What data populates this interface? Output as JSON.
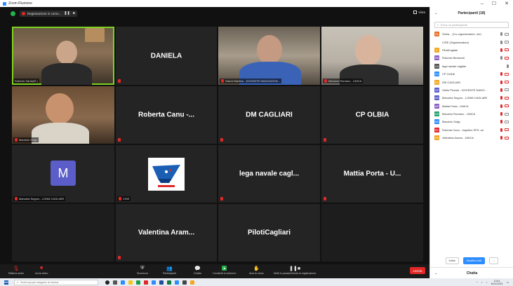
{
  "window": {
    "title": "Zoom Riunione"
  },
  "topbar": {
    "recording_label": "Registrazione in corso...",
    "view_label": "Vista"
  },
  "tiles": [
    {
      "kind": "video",
      "name": "Roberto Sardo(R.)",
      "active": true
    },
    {
      "kind": "name",
      "name": "DANIELA",
      "muted": true
    },
    {
      "kind": "video",
      "name": "Gianni Martino - DOCENTE NAVIGAZION..."
    },
    {
      "kind": "video",
      "name": "Maurizio Romano - UNICA"
    },
    {
      "kind": "video",
      "name": "Maurizio Solgo"
    },
    {
      "kind": "name",
      "name": "Roberta Canu -...",
      "muted": true
    },
    {
      "kind": "name",
      "name": "DM CAGLIARI",
      "muted": true
    },
    {
      "kind": "name",
      "name": "CP OLBIA",
      "muted": true
    },
    {
      "kind": "avatar",
      "name": "Manuela Seguro - LGNM CAGLIARI",
      "avatar_letter": "M"
    },
    {
      "kind": "logo",
      "name": "CISE"
    },
    {
      "kind": "name",
      "name": "lega navale cagl...",
      "muted": true
    },
    {
      "kind": "name",
      "name": "Mattia Porta - U...",
      "muted": true
    },
    {
      "kind": "empty",
      "name": ""
    },
    {
      "kind": "name",
      "name": "Valentina Aram...",
      "muted": true
    },
    {
      "kind": "name",
      "name": "PilotiCagliari",
      "muted": true
    },
    {
      "kind": "empty",
      "name": ""
    }
  ],
  "toolbar": {
    "audio_label": "Riattiva audio",
    "video_label": "Avvia video",
    "security_label": "Sicurezza",
    "participants_label": "Partecipanti",
    "participants_count": "18",
    "chat_label": "Chatta",
    "share_label": "Condividi lo schermo",
    "reactions_label": "Alza la mano",
    "record_label": "Metti in pausa/Arresta la registrazione",
    "leave_label": "Lascia"
  },
  "panel": {
    "title": "Partecipanti (18)",
    "search_placeholder": "Trova un partecipante",
    "participants": [
      {
        "initials": "GL",
        "color": "#e8702a",
        "name": "Giulia... (Co-organizzatore, me)",
        "mic": "on",
        "cam": "on"
      },
      {
        "initials": "",
        "color": "#1a5fb4",
        "name": "CISE (Organizzatore)",
        "mic": "on",
        "cam": "on",
        "bird": true
      },
      {
        "initials": "P",
        "color": "#f5a623",
        "name": "PilotiCagliari",
        "mic": "off",
        "cam": "off"
      },
      {
        "initials": "RB",
        "color": "#8a5fc7",
        "name": "Roberto Bertacchi",
        "mic": "on",
        "cam": "off"
      },
      {
        "initials": "LN",
        "color": "#555555",
        "name": "lega navale cagliari",
        "mic": "on",
        "cam": "none"
      },
      {
        "initials": "CO",
        "color": "#2d8cff",
        "name": "CP OLBIA",
        "mic": "off",
        "cam": "off"
      },
      {
        "initials": "DC",
        "color": "#f5a623",
        "name": "DM CAGLIARI",
        "mic": "off",
        "cam": "off"
      },
      {
        "initials": "GP",
        "color": "#5b5ec8",
        "name": "Giulio Piccolo - DOCENTE NAVIG...",
        "mic": "off",
        "cam": "on"
      },
      {
        "initials": "MS",
        "color": "#5b5ec8",
        "name": "Manuela Seguro - LGNM CAGLIARI",
        "mic": "off",
        "cam": "off"
      },
      {
        "initials": "MP",
        "color": "#8a5fc7",
        "name": "Mattia Porta - UNICA",
        "mic": "off",
        "cam": "off"
      },
      {
        "initials": "MR",
        "color": "#22a06b",
        "name": "Maurizio Romano - UNICA",
        "mic": "off",
        "cam": "on"
      },
      {
        "initials": "MS",
        "color": "#2d8cff",
        "name": "Maurizio Solgo",
        "mic": "off",
        "cam": "on"
      },
      {
        "initials": "RC",
        "color": "#e02828",
        "name": "Roberta Canu - Inquilino SPS..srl",
        "mic": "off",
        "cam": "off"
      },
      {
        "initials": "VA",
        "color": "#f5a623",
        "name": "Valentina Aramu - UNICA",
        "mic": "off",
        "cam": "off"
      }
    ],
    "invite_label": "Invita",
    "mute_all_label": "Disattiva tutti",
    "more_label": "...",
    "chat_title": "Chatta"
  },
  "taskbar": {
    "search_placeholder": "Scrivi qui per eseguire la ricerca",
    "time": "13:41",
    "date": "16/11/2021"
  }
}
